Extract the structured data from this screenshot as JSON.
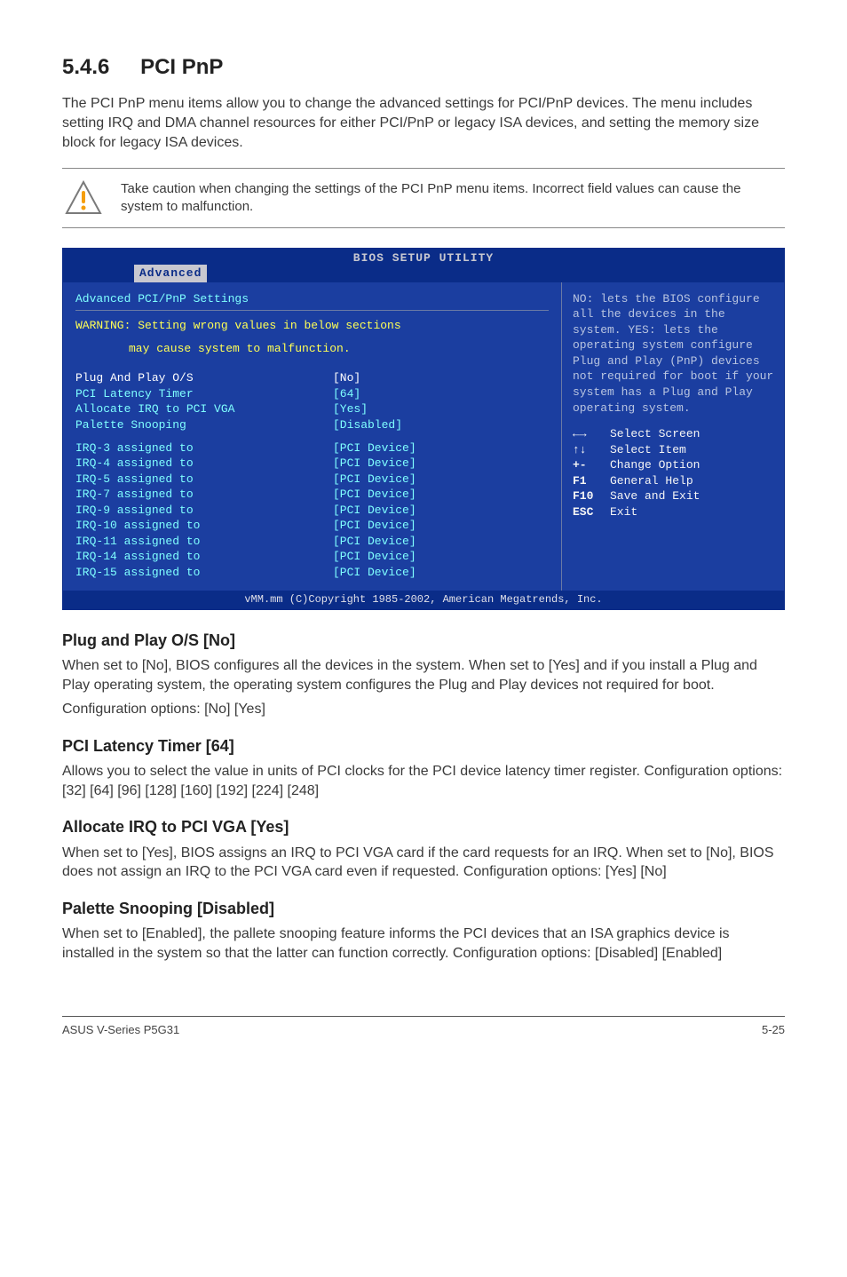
{
  "section": {
    "number": "5.4.6",
    "title": "PCI PnP",
    "intro": "The PCI PnP menu items allow you to change the advanced settings for PCI/PnP devices. The menu includes setting IRQ and DMA channel resources for either PCI/PnP or legacy ISA devices, and setting the memory size block for legacy ISA devices."
  },
  "note": "Take caution when changing the settings of the PCI PnP menu items. Incorrect field values can cause the system to malfunction.",
  "bios": {
    "header": "BIOS SETUP UTILITY",
    "tab": "Advanced",
    "panel_title": "Advanced PCI/PnP Settings",
    "warning_l1": "WARNING: Setting wrong values in below sections",
    "warning_l2": "may cause system to malfunction.",
    "top_items": [
      {
        "label": "Plug And Play O/S",
        "value": "[No]",
        "hl": true
      },
      {
        "label": "PCI Latency Timer",
        "value": "[64]"
      },
      {
        "label": "Allocate IRQ to PCI VGA",
        "value": "[Yes]"
      },
      {
        "label": "Palette Snooping",
        "value": "[Disabled]"
      }
    ],
    "irq_items": [
      {
        "label": "IRQ-3 assigned to",
        "value": "[PCI Device]"
      },
      {
        "label": "IRQ-4 assigned to",
        "value": "[PCI Device]"
      },
      {
        "label": "IRQ-5 assigned to",
        "value": "[PCI Device]"
      },
      {
        "label": "IRQ-7 assigned to",
        "value": "[PCI Device]"
      },
      {
        "label": "IRQ-9 assigned to",
        "value": "[PCI Device]"
      },
      {
        "label": "IRQ-10 assigned to",
        "value": "[PCI Device]"
      },
      {
        "label": "IRQ-11 assigned to",
        "value": "[PCI Device]"
      },
      {
        "label": "IRQ-14 assigned to",
        "value": "[PCI Device]"
      },
      {
        "label": "IRQ-15 assigned to",
        "value": "[PCI Device]"
      }
    ],
    "help": "NO: lets the BIOS configure  all the devices in the system. YES: lets the operating system configure Plug and Play (PnP) devices not required for boot if your system has a Plug and Play operating system.",
    "keys": [
      {
        "k": "←→",
        "t": "Select Screen"
      },
      {
        "k": "↑↓",
        "t": "Select Item"
      },
      {
        "k": "+-",
        "t": "Change Option"
      },
      {
        "k": "F1",
        "t": "General Help"
      },
      {
        "k": "F10",
        "t": "Save and Exit"
      },
      {
        "k": "ESC",
        "t": "Exit"
      }
    ],
    "footer": "vMM.mm (C)Copyright 1985-2002, American Megatrends, Inc."
  },
  "items": [
    {
      "title": "Plug and Play O/S [No]",
      "body": "When set to [No], BIOS configures all the devices in the system. When set to [Yes] and if you install a Plug and Play operating system, the operating system configures the Plug and Play devices not required for boot.",
      "config": "Configuration options: [No] [Yes]"
    },
    {
      "title": "PCI Latency Timer [64]",
      "body": "Allows you to select the value in units of PCI clocks for the PCI device latency timer register. Configuration options: [32] [64] [96] [128] [160] [192] [224] [248]",
      "config": ""
    },
    {
      "title": "Allocate IRQ to PCI VGA [Yes]",
      "body": "When set to [Yes], BIOS assigns an IRQ to PCI VGA card if the card requests for an IRQ. When set to [No], BIOS does not assign an IRQ to the PCI VGA card even if requested. Configuration options: [Yes] [No]",
      "config": ""
    },
    {
      "title": "Palette Snooping [Disabled]",
      "body": "When set to [Enabled], the pallete snooping feature informs the PCI devices that an ISA graphics device is installed in the system so that the latter can function correctly. Configuration options: [Disabled] [Enabled]",
      "config": ""
    }
  ],
  "footer": {
    "left": "ASUS  V-Series P5G31",
    "right": "5-25"
  }
}
